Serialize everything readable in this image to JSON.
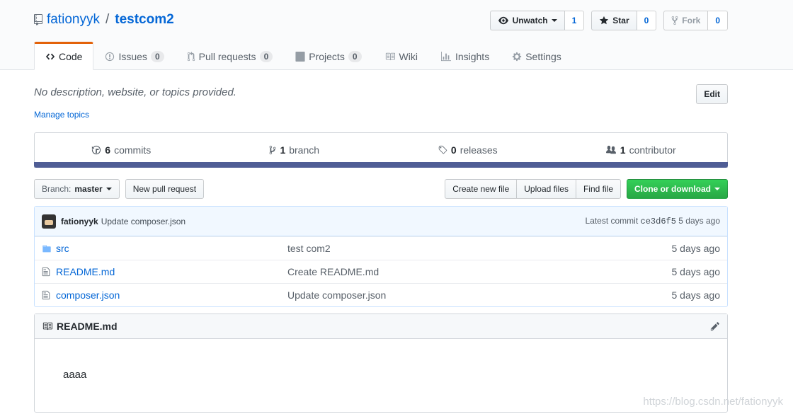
{
  "repo": {
    "owner": "fationyyk",
    "separator": "/",
    "name": "testcom2"
  },
  "actions": {
    "watch_label": "Unwatch",
    "watch_count": "1",
    "star_label": "Star",
    "star_count": "0",
    "fork_label": "Fork",
    "fork_count": "0"
  },
  "tabs": [
    {
      "label": "Code",
      "icon": "code-icon",
      "count": null
    },
    {
      "label": "Issues",
      "icon": "issue-icon",
      "count": "0"
    },
    {
      "label": "Pull requests",
      "icon": "pull-request-icon",
      "count": "0"
    },
    {
      "label": "Projects",
      "icon": "project-icon",
      "count": "0"
    },
    {
      "label": "Wiki",
      "icon": "book-icon",
      "count": null
    },
    {
      "label": "Insights",
      "icon": "graph-icon",
      "count": null
    },
    {
      "label": "Settings",
      "icon": "gear-icon",
      "count": null
    }
  ],
  "description": "No description, website, or topics provided.",
  "manage_topics": "Manage topics",
  "edit_label": "Edit",
  "summary": {
    "commits_count": "6",
    "commits_label": "commits",
    "branch_count": "1",
    "branch_label": "branch",
    "releases_count": "0",
    "releases_label": "releases",
    "contributor_count": "1",
    "contributor_label": "contributor"
  },
  "language_color": "#4F5D95",
  "file_nav": {
    "branch_prefix": "Branch:",
    "branch_name": "master",
    "new_pr": "New pull request",
    "create_file": "Create new file",
    "upload_files": "Upload files",
    "find_file": "Find file",
    "clone": "Clone or download"
  },
  "commit": {
    "author": "fationyyk",
    "message": "Update composer.json",
    "latest_label": "Latest commit",
    "sha": "ce3d6f5",
    "age": "5 days ago"
  },
  "files": [
    {
      "type": "folder",
      "name": "src",
      "message": "test com2",
      "age": "5 days ago"
    },
    {
      "type": "file",
      "name": "README.md",
      "message": "Create README.md",
      "age": "5 days ago"
    },
    {
      "type": "file",
      "name": "composer.json",
      "message": "Update composer.json",
      "age": "5 days ago"
    }
  ],
  "readme": {
    "title": "README.md",
    "body": "aaaa"
  },
  "watermark": "https://blog.csdn.net/fationyyk"
}
